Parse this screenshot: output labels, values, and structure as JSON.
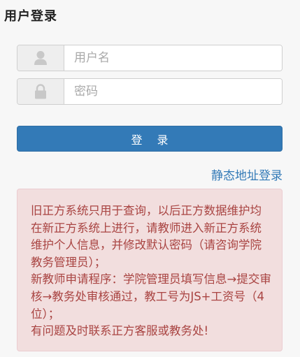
{
  "title": "用户登录",
  "username": {
    "icon": "user-icon",
    "placeholder": "用户名",
    "value": ""
  },
  "password": {
    "icon": "lock-icon",
    "placeholder": "密码",
    "value": ""
  },
  "login_button": "登 录",
  "static_login_link": "静态地址登录",
  "notice": {
    "line1": "旧正方系统只用于查询，以后正方数据维护均在新正方系统上进行，请教师进入新正方系统维护个人信息，并修改默认密码（请咨询学院教务管理员）；",
    "line2": "新教师申请程序：学院管理员填写信息→提交审核→教务处审核通过，教工号为JS+工资号（4位）；",
    "line3": "有问题及时联系正方客服或教务处!"
  },
  "colors": {
    "primary": "#337ab7",
    "alert_bg": "#f2dede",
    "alert_text": "#a94442"
  }
}
